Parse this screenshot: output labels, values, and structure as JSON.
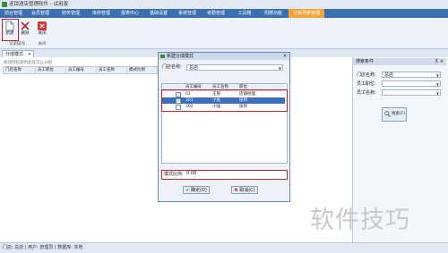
{
  "window": {
    "title": "连锁酒店管理软件 - 试用版"
  },
  "menu": {
    "items": [
      {
        "label": "前台管理"
      },
      {
        "label": "会员管理"
      },
      {
        "label": "财务管理"
      },
      {
        "label": "库存管理"
      },
      {
        "label": "报表中心"
      },
      {
        "label": "基础设置"
      },
      {
        "label": "系统管理"
      },
      {
        "label": "考勤管理"
      },
      {
        "label": "工具箱"
      },
      {
        "label": "附赠功能"
      },
      {
        "label": "分账列表管理"
      }
    ],
    "active_index": 10
  },
  "ribbon": {
    "new_label": "新建",
    "delete_label": "删除",
    "close_label": "关闭",
    "group1_label": "记录操作",
    "group2_label": "关闭"
  },
  "tab": {
    "label": "分成模式"
  },
  "main": {
    "hint": "拖动列标题到此处可以分组",
    "columns": [
      "门店名称",
      "员工职位",
      "员工编号",
      "员工名称",
      "模式比例"
    ]
  },
  "search_panel": {
    "title": "搜索条件",
    "store_label": "门店名称:",
    "store_value": "总店",
    "position_label": "员工职位:",
    "position_value": "",
    "name_label": "员工名称:",
    "name_value": "",
    "search_button": "搜索(F)"
  },
  "dialog": {
    "title": "新建分成模式",
    "store_label": "门店名称:",
    "store_value": "总店",
    "columns": [
      "",
      "员工编号",
      "员工名称",
      "职位"
    ],
    "rows": [
      {
        "checked": true,
        "code": "01",
        "name": "王丽",
        "position": "店铺经理",
        "selected": false
      },
      {
        "checked": true,
        "code": "301",
        "name": "小张",
        "position": "技师",
        "selected": true
      },
      {
        "checked": false,
        "code": "302",
        "name": "小强",
        "position": "技师",
        "selected": false
      }
    ],
    "ratio_label": "模式比例:",
    "ratio_value": "0.08",
    "ok_label": "确定(O)",
    "cancel_label": "取消(C)"
  },
  "statusbar": {
    "text": "门店: 总店 | 用户: 管理员 | 数据库: 本地"
  },
  "watermark": {
    "text": "软件技巧"
  },
  "colors": {
    "menubar": "#3b6fb0",
    "active_menu": "#f4a23c",
    "highlight": "#c0202a",
    "selected_row": "#3d6fc0"
  }
}
